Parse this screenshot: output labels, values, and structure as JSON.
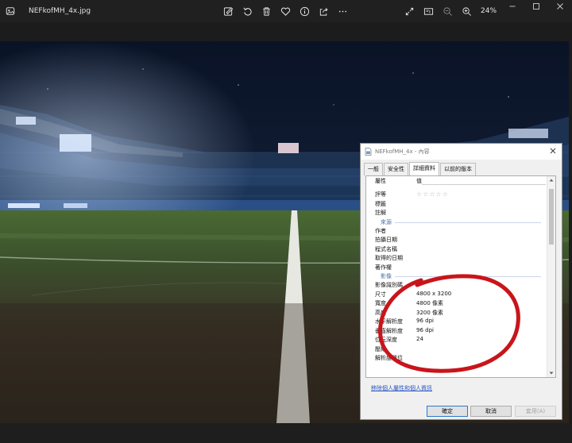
{
  "window": {
    "file_name": "NEFkofMH_4x.jpg",
    "zoom": "24%"
  },
  "toolbar": {
    "icons": [
      "edit-image-icon",
      "rotate-icon",
      "delete-icon",
      "favorite-icon",
      "info-icon",
      "share-icon",
      "more-icon"
    ],
    "right_icons": [
      "expand-icon",
      "slideshow-icon",
      "zoom-out-icon",
      "zoom-in-icon"
    ]
  },
  "dialog": {
    "title": "NEFkofMH_4x - 內容",
    "tabs": [
      "一般",
      "安全性",
      "詳細資料",
      "以前的版本"
    ],
    "active_tab": "詳細資料",
    "header": {
      "name": "屬性",
      "value": "值"
    },
    "groups": {
      "source": "來源",
      "image": "影像"
    },
    "rows_top": [
      {
        "name": "評等",
        "value": "☆☆☆☆☆"
      },
      {
        "name": "標籤",
        "value": ""
      },
      {
        "name": "註解",
        "value": ""
      }
    ],
    "rows_source": [
      {
        "name": "作者",
        "value": ""
      },
      {
        "name": "拍攝日期",
        "value": ""
      },
      {
        "name": "程式名稱",
        "value": ""
      },
      {
        "name": "取得的日期",
        "value": ""
      },
      {
        "name": "著作權",
        "value": ""
      }
    ],
    "rows_image": [
      {
        "name": "影像識別碼",
        "value": ""
      },
      {
        "name": "尺寸",
        "value": "4800 x 3200"
      },
      {
        "name": "寬度",
        "value": "4800 像素"
      },
      {
        "name": "高度",
        "value": "3200 像素"
      },
      {
        "name": "水平解析度",
        "value": "96 dpi"
      },
      {
        "name": "垂直解析度",
        "value": "96 dpi"
      },
      {
        "name": "位元深度",
        "value": "24"
      },
      {
        "name": "壓縮",
        "value": ""
      },
      {
        "name": "解析度單位",
        "value": ""
      }
    ],
    "remove_link": "移除個人屬性和個人資訊",
    "buttons": {
      "ok": "確定",
      "cancel": "取消",
      "apply": "套用(A)"
    }
  },
  "colors": {
    "annotation": "#c8151b",
    "link": "#2b57c5",
    "accent": "#2a78d4"
  }
}
